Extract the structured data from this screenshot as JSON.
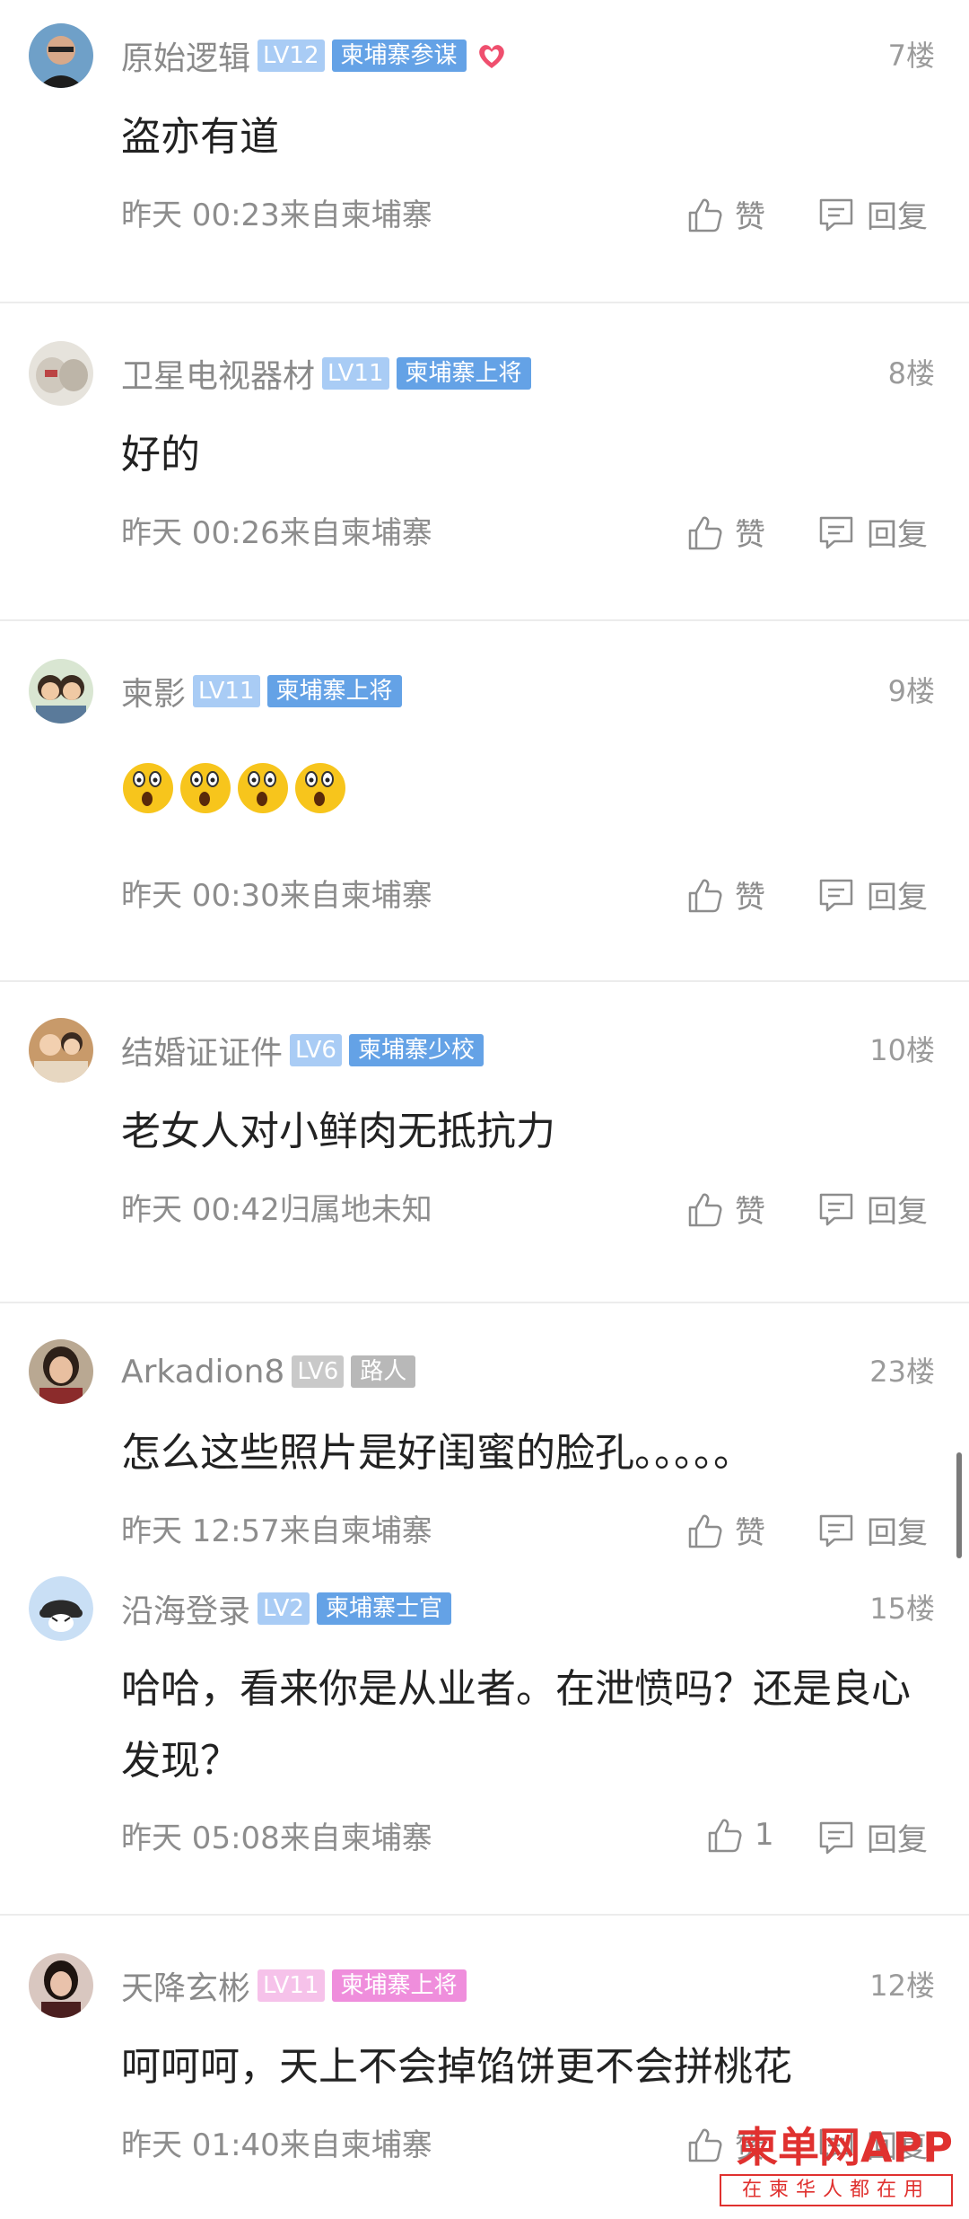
{
  "comments": [
    {
      "name": "原始逻辑",
      "level": "LV12",
      "title": "柬埔寨参谋",
      "floor": "7楼",
      "content": "盗亦有道",
      "time": "昨天 00:23来自柬埔寨",
      "like": "赞",
      "reply": "回复"
    },
    {
      "name": "卫星电视器材",
      "level": "LV11",
      "title": "柬埔寨上将",
      "floor": "8楼",
      "content": "好的",
      "time": "昨天 00:26来自柬埔寨",
      "like": "赞",
      "reply": "回复"
    },
    {
      "name": "柬影",
      "level": "LV11",
      "title": "柬埔寨上将",
      "floor": "9楼",
      "content": "",
      "emoji_count": 4,
      "time": "昨天 00:30来自柬埔寨",
      "like": "赞",
      "reply": "回复"
    },
    {
      "name": "结婚证证件",
      "level": "LV6",
      "title": "柬埔寨少校",
      "floor": "10楼",
      "content": "老女人对小鲜肉无抵抗力",
      "time": "昨天 00:42归属地未知",
      "like": "赞",
      "reply": "回复"
    },
    {
      "name": "Arkadion8",
      "level": "LV6",
      "title": "路人",
      "floor": "23楼",
      "content": "怎么这些照片是好闺蜜的脸孔。。。。。",
      "time": "昨天 12:57来自柬埔寨",
      "like": "赞",
      "reply": "回复"
    },
    {
      "name": "沿海登录",
      "level": "LV2",
      "title": "柬埔寨士官",
      "floor": "15楼",
      "content": "哈哈，看来你是从业者。在泄愤吗？还是良心发现？",
      "time": "昨天 05:08来自柬埔寨",
      "like": "1",
      "reply": "回复"
    },
    {
      "name": "天降玄彬",
      "level": "LV11",
      "title": "柬埔寨上将",
      "floor": "12楼",
      "content": "呵呵呵，天上不会掉馅饼更不会拼桃花",
      "time": "昨天 01:40来自柬埔寨",
      "like": "赞",
      "reply": "回复"
    }
  ],
  "watermark": {
    "main": "柬单网APP",
    "sub": "在柬华人都在用"
  },
  "colors": {
    "lv_badge": "#a9ccf5",
    "title_badge": "#64a2e6",
    "pink_badge": "#ef8edc",
    "grey_badge": "#b8b8b8",
    "watermark": "#e0312f"
  }
}
